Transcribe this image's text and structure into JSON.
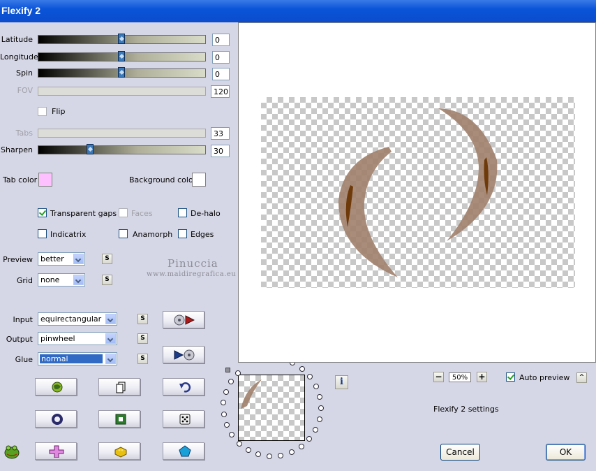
{
  "window": {
    "title": "Flexify 2"
  },
  "sliders": {
    "latitude": {
      "label": "Latitude",
      "value": "0",
      "level": 0.5
    },
    "longitude": {
      "label": "Longitude",
      "value": "0",
      "level": 0.5
    },
    "spin": {
      "label": "Spin",
      "value": "0",
      "level": 0.5
    },
    "fov": {
      "label": "FOV",
      "value": "120",
      "disabled": true
    },
    "tabs": {
      "label": "Tabs",
      "value": "33",
      "disabled": true
    },
    "sharpen": {
      "label": "Sharpen",
      "value": "30",
      "level": 0.3
    }
  },
  "flip": {
    "label": "Flip",
    "checked": false
  },
  "colors": {
    "tab_color_label": "Tab color",
    "tab_color": "#ffc0ff",
    "background_color_label": "Background color",
    "background_color": "#ffffff"
  },
  "options": {
    "transparent_gaps": {
      "label": "Transparent gaps",
      "checked": true
    },
    "faces": {
      "label": "Faces",
      "checked": false,
      "disabled": true
    },
    "de_halo": {
      "label": "De-halo",
      "checked": false
    },
    "indicatrix": {
      "label": "Indicatrix",
      "checked": false
    },
    "anamorph": {
      "label": "Anamorph",
      "checked": false
    },
    "edges": {
      "label": "Edges",
      "checked": false
    }
  },
  "selects": {
    "preview": {
      "label": "Preview",
      "value": "better"
    },
    "grid": {
      "label": "Grid",
      "value": "none"
    },
    "input": {
      "label": "Input",
      "value": "equirectangular"
    },
    "output": {
      "label": "Output",
      "value": "pinwheel"
    },
    "glue": {
      "label": "Glue",
      "value": "normal"
    }
  },
  "small_button_glyph": "S",
  "watermark": {
    "line1": "Pinuccia",
    "line2": "www.maidiregrafica.eu"
  },
  "zoom": {
    "value": "50%",
    "minus": "−",
    "plus": "+"
  },
  "auto_preview": {
    "label": "Auto preview",
    "checked": true
  },
  "settings_label": "Flexify 2 settings",
  "info_glyph": "i",
  "up_glyph": "^",
  "buttons": {
    "cancel": "Cancel",
    "ok": "OK"
  },
  "icons": {
    "swap_in": "disc-arrow-icon",
    "swap_out": "arrow-disc-icon",
    "grid1": [
      "globe-icon",
      "copy-icon",
      "undo-icon"
    ],
    "grid2": [
      "ring-icon",
      "frame-icon",
      "dice-icon"
    ],
    "grid3": [
      "cross-icon",
      "brick-icon",
      "pentagon-icon"
    ]
  },
  "accent": {
    "preview_shape": "#a0806a",
    "preview_stripe": "#6e3a0a"
  }
}
